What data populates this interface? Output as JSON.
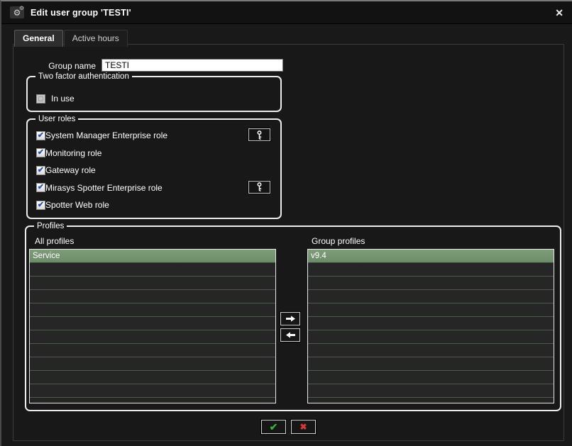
{
  "window": {
    "title": "Edit user group 'TESTI'"
  },
  "tabs": [
    {
      "label": "General",
      "active": true
    },
    {
      "label": "Active hours",
      "active": false
    }
  ],
  "form": {
    "group_name_label": "Group name",
    "group_name_value": "TESTI",
    "two_factor": {
      "legend": "Two factor authentication",
      "checkbox_label": "In use",
      "checked": false
    },
    "user_roles": {
      "legend": "User roles",
      "roles": [
        {
          "label": "System Manager Enterprise role",
          "checked": true,
          "has_key_button": true
        },
        {
          "label": "Monitoring role",
          "checked": true,
          "has_key_button": false
        },
        {
          "label": "Gateway role",
          "checked": true,
          "has_key_button": false
        },
        {
          "label": "Mirasys Spotter Enterprise role",
          "checked": true,
          "has_key_button": true
        },
        {
          "label": "Spotter Web role",
          "checked": true,
          "has_key_button": false
        }
      ]
    },
    "profiles": {
      "legend": "Profiles",
      "all_profiles_label": "All profiles",
      "group_profiles_label": "Group profiles",
      "all_profiles_selected": "Service",
      "group_profiles_selected": "v9.4"
    }
  },
  "icons": {
    "title_gear_big": "⚙",
    "title_gear_small": "⚙",
    "close": "✕",
    "checkbox_check": "✔",
    "ok": "✔",
    "cancel": "✖"
  },
  "colors": {
    "selected_row_green": "#74926f",
    "ok_green": "#35b135",
    "cancel_red": "#d93636",
    "fieldset_border": "#ececec",
    "window_bg": "#191919"
  }
}
